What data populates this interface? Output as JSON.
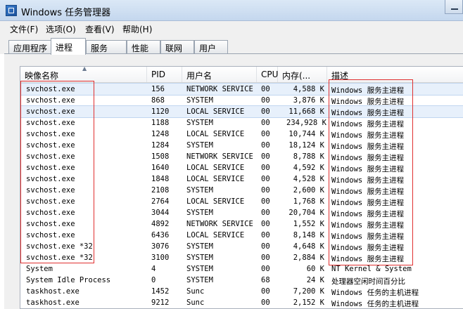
{
  "window": {
    "title": "Windows 任务管理器"
  },
  "menu": [
    "文件(F)",
    "选项(O)",
    "查看(V)",
    "帮助(H)"
  ],
  "tabs": [
    "应用程序",
    "进程",
    "服务",
    "性能",
    "联网",
    "用户"
  ],
  "columns": [
    "映像名称",
    "PID",
    "用户名",
    "CPU",
    "内存(...",
    "描述"
  ],
  "rows": [
    {
      "name": "svchost.exe",
      "pid": "156",
      "user": "NETWORK SERVICE",
      "cpu": "00",
      "mem": "4,588 K",
      "desc": "Windows 服务主进程"
    },
    {
      "name": "svchost.exe",
      "pid": "868",
      "user": "SYSTEM",
      "cpu": "00",
      "mem": "3,876 K",
      "desc": "Windows 服务主进程"
    },
    {
      "name": "svchost.exe",
      "pid": "1120",
      "user": "LOCAL SERVICE",
      "cpu": "00",
      "mem": "11,668 K",
      "desc": "Windows 服务主进程"
    },
    {
      "name": "svchost.exe",
      "pid": "1188",
      "user": "SYSTEM",
      "cpu": "00",
      "mem": "234,928 K",
      "desc": "Windows 服务主进程"
    },
    {
      "name": "svchost.exe",
      "pid": "1248",
      "user": "LOCAL SERVICE",
      "cpu": "00",
      "mem": "10,744 K",
      "desc": "Windows 服务主进程"
    },
    {
      "name": "svchost.exe",
      "pid": "1284",
      "user": "SYSTEM",
      "cpu": "00",
      "mem": "18,124 K",
      "desc": "Windows 服务主进程"
    },
    {
      "name": "svchost.exe",
      "pid": "1508",
      "user": "NETWORK SERVICE",
      "cpu": "00",
      "mem": "8,788 K",
      "desc": "Windows 服务主进程"
    },
    {
      "name": "svchost.exe",
      "pid": "1640",
      "user": "LOCAL SERVICE",
      "cpu": "00",
      "mem": "4,592 K",
      "desc": "Windows 服务主进程"
    },
    {
      "name": "svchost.exe",
      "pid": "1848",
      "user": "LOCAL SERVICE",
      "cpu": "00",
      "mem": "4,528 K",
      "desc": "Windows 服务主进程"
    },
    {
      "name": "svchost.exe",
      "pid": "2108",
      "user": "SYSTEM",
      "cpu": "00",
      "mem": "2,600 K",
      "desc": "Windows 服务主进程"
    },
    {
      "name": "svchost.exe",
      "pid": "2764",
      "user": "LOCAL SERVICE",
      "cpu": "00",
      "mem": "1,768 K",
      "desc": "Windows 服务主进程"
    },
    {
      "name": "svchost.exe",
      "pid": "3044",
      "user": "SYSTEM",
      "cpu": "00",
      "mem": "20,704 K",
      "desc": "Windows 服务主进程"
    },
    {
      "name": "svchost.exe",
      "pid": "4892",
      "user": "NETWORK SERVICE",
      "cpu": "00",
      "mem": "1,552 K",
      "desc": "Windows 服务主进程"
    },
    {
      "name": "svchost.exe",
      "pid": "6436",
      "user": "LOCAL SERVICE",
      "cpu": "00",
      "mem": "8,148 K",
      "desc": "Windows 服务主进程"
    },
    {
      "name": "svchost.exe *32",
      "pid": "3076",
      "user": "SYSTEM",
      "cpu": "00",
      "mem": "4,648 K",
      "desc": "Windows 服务主进程"
    },
    {
      "name": "svchost.exe *32",
      "pid": "3100",
      "user": "SYSTEM",
      "cpu": "00",
      "mem": "2,884 K",
      "desc": "Windows 服务主进程"
    },
    {
      "name": "System",
      "pid": "4",
      "user": "SYSTEM",
      "cpu": "00",
      "mem": "60 K",
      "desc": "NT Kernel & System"
    },
    {
      "name": "System Idle Process",
      "pid": "0",
      "user": "SYSTEM",
      "cpu": "68",
      "mem": "24 K",
      "desc": "处理器空闲时间百分比"
    },
    {
      "name": "taskhost.exe",
      "pid": "1452",
      "user": "Sunc",
      "cpu": "00",
      "mem": "7,200 K",
      "desc": "Windows 任务的主机进程"
    },
    {
      "name": "taskhost.exe",
      "pid": "9212",
      "user": "Sunc",
      "cpu": "00",
      "mem": "2,152 K",
      "desc": "Windows 任务的主机进程"
    }
  ],
  "colors": {
    "selected_row": "#e7f0fb",
    "highlight_box": "#e03030"
  }
}
